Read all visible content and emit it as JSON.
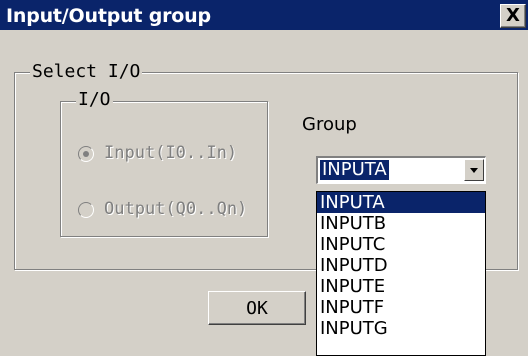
{
  "window": {
    "title": "Input/Output group",
    "close_symbol": "X"
  },
  "select_io": {
    "label": "Select I/O",
    "io_group": {
      "label": "I/O",
      "options": [
        {
          "label": "Input(I0..In)",
          "checked": true,
          "disabled": true
        },
        {
          "label": "Output(Q0..Qn)",
          "checked": false,
          "disabled": true
        }
      ]
    },
    "group_label": "Group",
    "combo": {
      "value": "INPUTA",
      "options": [
        "INPUTA",
        "INPUTB",
        "INPUTC",
        "INPUTD",
        "INPUTE",
        "INPUTF",
        "INPUTG"
      ],
      "selected_index": 0
    }
  },
  "buttons": {
    "ok": "OK"
  },
  "colors": {
    "titlebar": "#0a246a",
    "face": "#d4d0c8",
    "highlight": "#0a246a",
    "disabled_text": "#808080"
  }
}
